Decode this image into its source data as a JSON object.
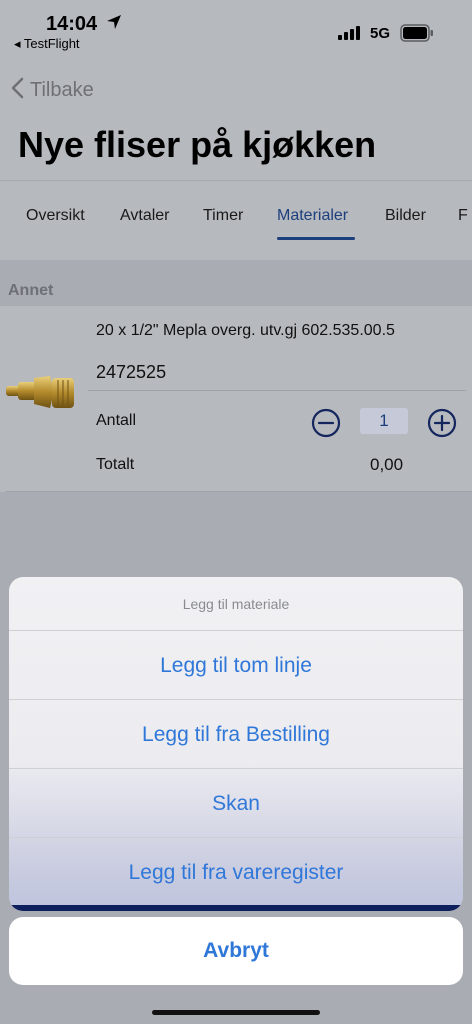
{
  "status_bar": {
    "time": "14:04",
    "back_app": "◂ TestFlight",
    "network": "5G"
  },
  "nav": {
    "back_label": "Tilbake",
    "title": "Nye fliser på kjøkken"
  },
  "tabs": [
    {
      "label": "Oversikt"
    },
    {
      "label": "Avtaler"
    },
    {
      "label": "Timer"
    },
    {
      "label": "Materialer",
      "active": true
    },
    {
      "label": "Bilder"
    },
    {
      "label": "F"
    }
  ],
  "material_list": {
    "section": "Annet",
    "items": [
      {
        "name": "20 x 1/2\" Mepla overg. utv.gj 602.535.00.5",
        "number": "2472525",
        "quantity_label": "Antall",
        "quantity": "1",
        "total_label": "Totalt",
        "total_value": "0,00"
      }
    ]
  },
  "action_sheet": {
    "title": "Legg til materiale",
    "options": [
      {
        "label": "Legg til tom linje"
      },
      {
        "label": "Legg til fra Bestilling"
      },
      {
        "label": "Skan"
      },
      {
        "label": "Legg til fra vareregister"
      }
    ],
    "cancel": "Avbryt"
  },
  "colors": {
    "accent_blue": "#2f77d8",
    "nav_blue": "#1d3f7c",
    "dimmed_background": "#b6b9be"
  },
  "icons": {
    "back": "chevron-left-icon",
    "location": "location-arrow-icon",
    "signal": "cellular-signal-icon",
    "battery": "battery-icon",
    "minus": "minus-circle-icon",
    "plus": "plus-circle-icon",
    "product": "brass-fitting-image"
  }
}
